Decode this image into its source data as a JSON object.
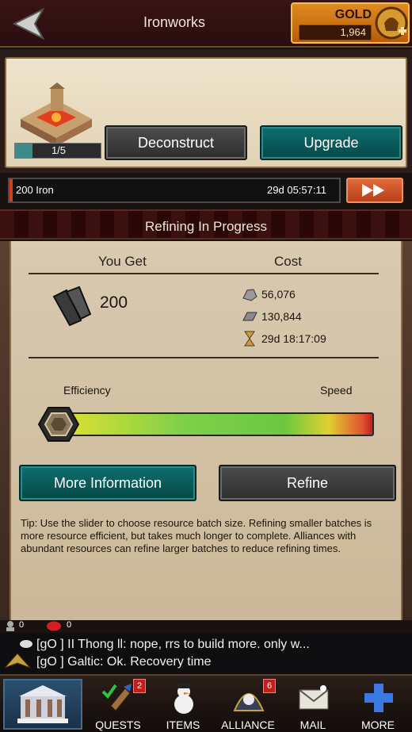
{
  "header": {
    "title": "Ironworks",
    "gold_label": "GOLD",
    "gold_value": "1,964"
  },
  "building": {
    "level_text": "1/5",
    "level_progress": 0.2,
    "deconstruct_label": "Deconstruct",
    "upgrade_label": "Upgrade"
  },
  "progress": {
    "label": "200 Iron",
    "time_remaining": "29d 05:57:11",
    "fraction": 0.01
  },
  "section_title": "Refining In Progress",
  "refine": {
    "you_get_header": "You Get",
    "cost_header": "Cost",
    "get_value": "200",
    "costs": [
      {
        "icon": "stone-icon",
        "value": "56,076"
      },
      {
        "icon": "iron-ingot-icon",
        "value": "130,844"
      },
      {
        "icon": "hourglass-icon",
        "value": "29d 18:17:09"
      }
    ],
    "efficiency_label": "Efficiency",
    "speed_label": "Speed",
    "slider_level": 0,
    "more_info_label": "More Information",
    "refine_label": "Refine",
    "tip": "Tip: Use the slider to choose resource batch size. Refining smaller batches is more resource efficient, but takes much longer to complete. Alliances with abundant resources can refine larger batches to reduce refining times."
  },
  "status": {
    "players_count": "0",
    "gems_count": "0"
  },
  "chat": {
    "line1": "[gO ] II Thong ll: nope,  rrs to build more.  only w...",
    "line2": "[gO ] Galtic: Ok. Recovery time"
  },
  "nav": {
    "quests": {
      "label": "QUESTS",
      "badge": "2"
    },
    "items": {
      "label": "ITEMS"
    },
    "alliance": {
      "label": "ALLIANCE",
      "badge": "6"
    },
    "mail": {
      "label": "MAIL"
    },
    "more": {
      "label": "MORE"
    }
  },
  "colors": {
    "teal_button": "#064848",
    "gray_button": "#2d2d2d",
    "gold": "#e08a20",
    "badge": "#c0201a"
  }
}
